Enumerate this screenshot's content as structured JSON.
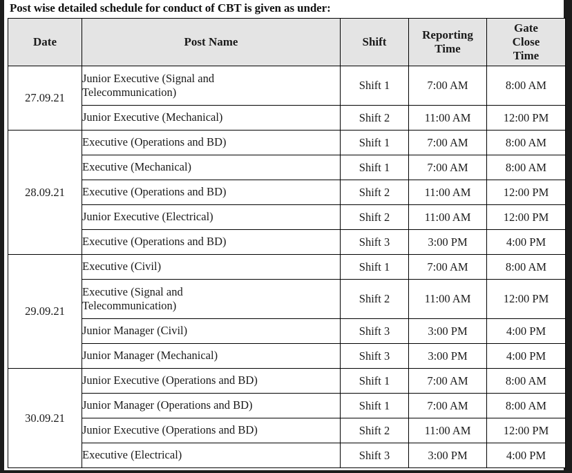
{
  "document": {
    "heading": "Post wise detailed schedule for conduct of CBT is given as under:"
  },
  "table": {
    "headers": {
      "date": "Date",
      "post_name": "Post Name",
      "shift": "Shift",
      "reporting_time": "Reporting Time",
      "reporting_time_line1": "Reporting",
      "reporting_time_line2": "Time",
      "gate_close_time": "Gate Close Time",
      "gate_close_line1": "Gate",
      "gate_close_line2": "Close",
      "gate_close_line3": "Time"
    },
    "groups": [
      {
        "date": "27.09.21",
        "rows": [
          {
            "post_name": "Junior Executive (Signal and Telecommunication)",
            "post_name_line1": "Junior Executive (Signal and",
            "post_name_line2": "Telecommunication)",
            "shift": "Shift 1",
            "reporting_time": "7:00 AM",
            "gate_close_time": "8:00 AM",
            "tall": true
          },
          {
            "post_name": "Junior Executive (Mechanical)",
            "shift": "Shift 2",
            "reporting_time": "11:00 AM",
            "gate_close_time": "12:00 PM",
            "tall": false
          }
        ]
      },
      {
        "date": "28.09.21",
        "rows": [
          {
            "post_name": "Executive (Operations and BD)",
            "shift": "Shift 1",
            "reporting_time": "7:00 AM",
            "gate_close_time": "8:00 AM",
            "tall": false
          },
          {
            "post_name": "Executive (Mechanical)",
            "shift": "Shift 1",
            "reporting_time": "7:00 AM",
            "gate_close_time": "8:00 AM",
            "tall": false
          },
          {
            "post_name": "Executive (Operations and BD)",
            "shift": "Shift 2",
            "reporting_time": "11:00 AM",
            "gate_close_time": "12:00 PM",
            "tall": false
          },
          {
            "post_name": "Junior Executive (Electrical)",
            "shift": "Shift 2",
            "reporting_time": "11:00 AM",
            "gate_close_time": "12:00 PM",
            "tall": false
          },
          {
            "post_name": "Executive (Operations and BD)",
            "shift": "Shift 3",
            "reporting_time": "3:00 PM",
            "gate_close_time": "4:00 PM",
            "tall": false
          }
        ]
      },
      {
        "date": "29.09.21",
        "rows": [
          {
            "post_name": "Executive (Civil)",
            "shift": "Shift 1",
            "reporting_time": "7:00 AM",
            "gate_close_time": "8:00 AM",
            "tall": false
          },
          {
            "post_name": "Executive (Signal and Telecommunication)",
            "post_name_line1": "Executive (Signal and",
            "post_name_line2": "Telecommunication)",
            "shift": "Shift 2",
            "reporting_time": "11:00 AM",
            "gate_close_time": "12:00 PM",
            "tall": true
          },
          {
            "post_name": "Junior Manager (Civil)",
            "shift": "Shift 3",
            "reporting_time": "3:00 PM",
            "gate_close_time": "4:00 PM",
            "tall": false
          },
          {
            "post_name": "Junior Manager (Mechanical)",
            "shift": "Shift 3",
            "reporting_time": "3:00 PM",
            "gate_close_time": "4:00 PM",
            "tall": false
          }
        ]
      },
      {
        "date": "30.09.21",
        "rows": [
          {
            "post_name": "Junior Executive (Operations and BD)",
            "shift": "Shift 1",
            "reporting_time": "7:00 AM",
            "gate_close_time": "8:00 AM",
            "tall": false
          },
          {
            "post_name": "Junior Manager (Operations and BD)",
            "shift": "Shift 1",
            "reporting_time": "7:00 AM",
            "gate_close_time": "8:00 AM",
            "tall": false
          },
          {
            "post_name": "Junior Executive (Operations and BD)",
            "shift": "Shift 2",
            "reporting_time": "11:00 AM",
            "gate_close_time": "12:00 PM",
            "tall": false
          },
          {
            "post_name": "Executive (Electrical)",
            "shift": "Shift 3",
            "reporting_time": "3:00 PM",
            "gate_close_time": "4:00 PM",
            "tall": false
          }
        ]
      }
    ]
  }
}
